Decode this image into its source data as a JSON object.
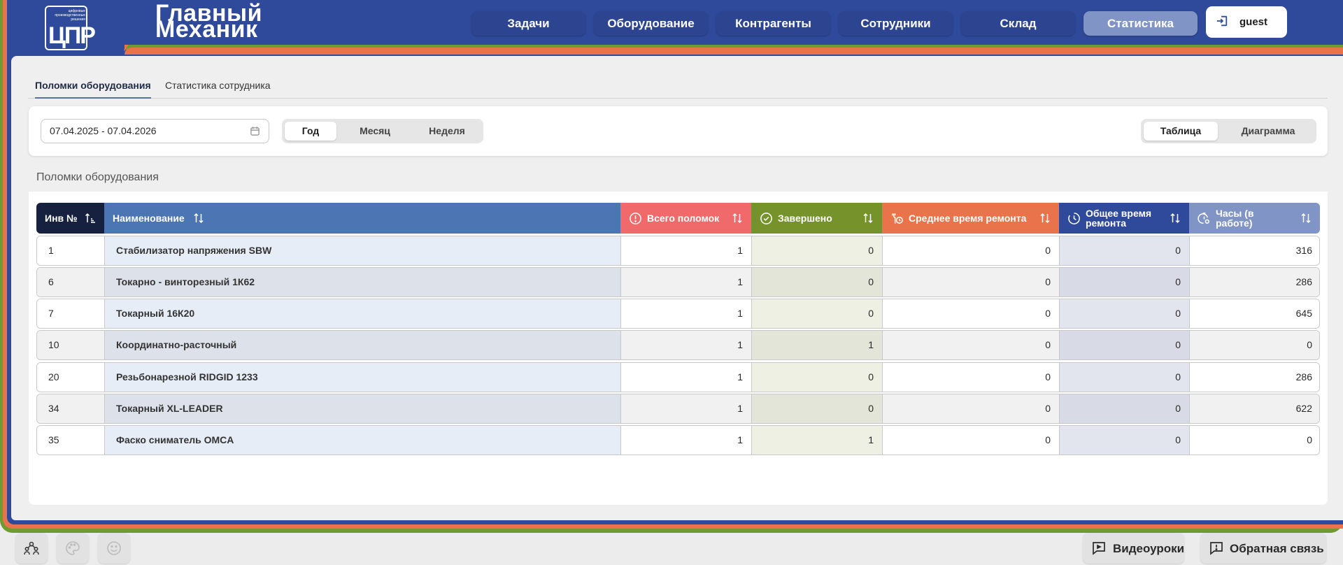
{
  "brand": {
    "logo_small_text": "цифровые производственные решения",
    "logo_mark": "ЦПР",
    "title_line1": "Главный",
    "title_line2": "Механик"
  },
  "nav": {
    "items": [
      {
        "label": "Задачи"
      },
      {
        "label": "Оборудование"
      },
      {
        "label": "Контрагенты"
      },
      {
        "label": "Сотрудники"
      },
      {
        "label": "Склад"
      },
      {
        "label": "Статистика",
        "active": true
      }
    ],
    "user_name": "guest"
  },
  "subtabs": [
    {
      "label": "Поломки оборудования",
      "active": true
    },
    {
      "label": "Статистика сотрудника"
    }
  ],
  "filters": {
    "date_range": "07.04.2025 - 07.04.2026",
    "periods": [
      "Год",
      "Месяц",
      "Неделя"
    ],
    "active_period": "Год",
    "views": [
      "Таблица",
      "Диаграмма"
    ],
    "active_view": "Таблица"
  },
  "section_title": "Поломки оборудования",
  "table": {
    "columns": [
      {
        "label": "Инв №",
        "color": "#16213f"
      },
      {
        "label": "Наименование",
        "color": "#4b76b3"
      },
      {
        "label": "Всего поломок",
        "color": "#f0696b"
      },
      {
        "label": "Завершено",
        "color": "#76922a"
      },
      {
        "label": "Среднее время ремонта",
        "color": "#e9734a"
      },
      {
        "label": "Общее время ремонта",
        "color": "#2f4a9a"
      },
      {
        "label": "Часы (в работе)",
        "color": "#8194c6"
      }
    ],
    "rows": [
      {
        "inv": "1",
        "name": "Стабилизатор напряжения SBW",
        "total": "1",
        "done": "0",
        "avg": "0",
        "sum": "0",
        "hours": "316"
      },
      {
        "inv": "6",
        "name": "Токарно - винторезный 1К62",
        "total": "1",
        "done": "0",
        "avg": "0",
        "sum": "0",
        "hours": "286"
      },
      {
        "inv": "7",
        "name": "Токарный 16К20",
        "total": "1",
        "done": "0",
        "avg": "0",
        "sum": "0",
        "hours": "645"
      },
      {
        "inv": "10",
        "name": "Координатно-расточный",
        "total": "1",
        "done": "1",
        "avg": "0",
        "sum": "0",
        "hours": "0"
      },
      {
        "inv": "20",
        "name": "Резьбонарезной RIDGID 1233",
        "total": "1",
        "done": "0",
        "avg": "0",
        "sum": "0",
        "hours": "286"
      },
      {
        "inv": "34",
        "name": "Токарный XL-LEADER",
        "total": "1",
        "done": "0",
        "avg": "0",
        "sum": "0",
        "hours": "622"
      },
      {
        "inv": "35",
        "name": "Фаско сниматель OMCA",
        "total": "1",
        "done": "1",
        "avg": "0",
        "sum": "0",
        "hours": "0"
      }
    ]
  },
  "bottom": {
    "video_label": "Видеоуроки",
    "feedback_label": "Обратная связь"
  }
}
